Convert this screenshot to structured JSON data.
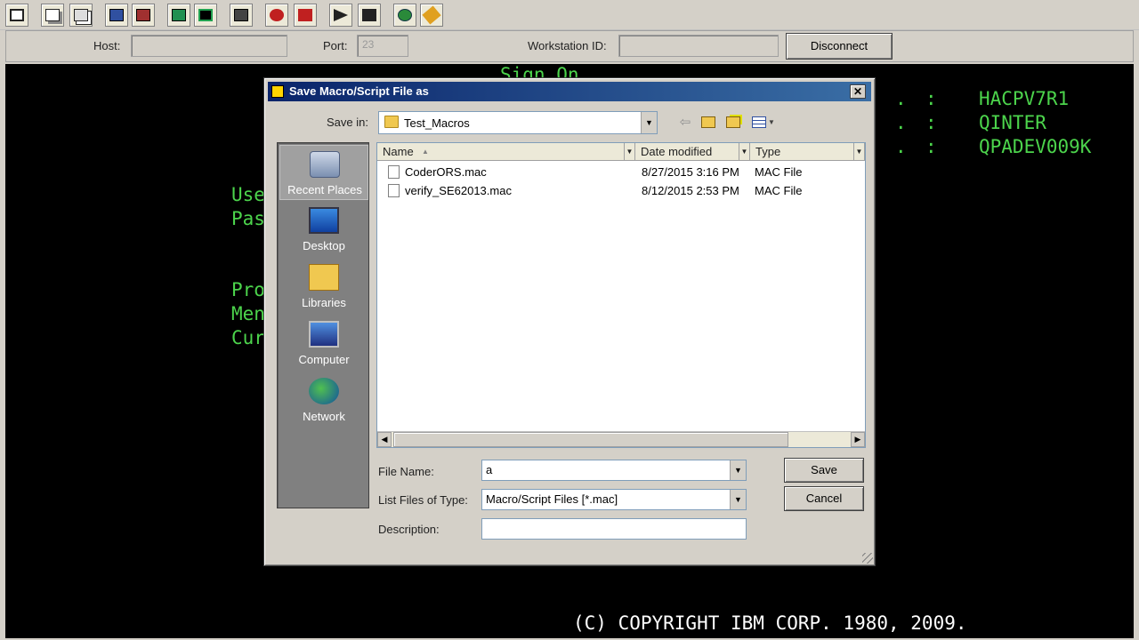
{
  "toolbar": {
    "icons": [
      "display-icon",
      "copy-icon",
      "paste-icon",
      "send-icon",
      "receive-icon",
      "keypad-icon",
      "display-settings-icon",
      "print-icon",
      "record-macro-icon",
      "stop-macro-icon",
      "play-macro-icon",
      "macro-step-icon",
      "globe-icon",
      "edit-macro-icon"
    ]
  },
  "hostbar": {
    "host_label": "Host:",
    "host_value": "",
    "port_label": "Port:",
    "port_value": "23",
    "workstation_label": "Workstation ID:",
    "workstation_value": "",
    "disconnect_label": "Disconnect"
  },
  "terminal": {
    "header_partial": "Sign On",
    "system_value": "HACPV7R1",
    "subsystem_value": "QINTER",
    "display_value": "QPADEV009K",
    "colon": ":",
    "dot": ".",
    "user_partial": "Use",
    "password_partial": "Pas",
    "program_partial": "Pro",
    "menu_partial": "Men",
    "current_partial": "Cur",
    "copyright": "(C) COPYRIGHT IBM CORP. 1980, 2009."
  },
  "dialog": {
    "title": "Save Macro/Script File as",
    "save_in_label": "Save in:",
    "save_in_value": "Test_Macros",
    "places": [
      {
        "label": "Recent Places",
        "icon": "recent-places-icon"
      },
      {
        "label": "Desktop",
        "icon": "desktop-icon"
      },
      {
        "label": "Libraries",
        "icon": "libraries-icon"
      },
      {
        "label": "Computer",
        "icon": "computer-icon"
      },
      {
        "label": "Network",
        "icon": "network-icon"
      }
    ],
    "columns": {
      "name": "Name",
      "date": "Date modified",
      "type": "Type"
    },
    "files": [
      {
        "name": "CoderORS.mac",
        "date": "8/27/2015 3:16 PM",
        "type": "MAC File"
      },
      {
        "name": "verify_SE62013.mac",
        "date": "8/12/2015 2:53 PM",
        "type": "MAC File"
      }
    ],
    "file_name_label": "File Name:",
    "file_name_value": "a",
    "file_type_label": "List Files of Type:",
    "file_type_value": "Macro/Script Files [*.mac]",
    "description_label": "Description:",
    "description_value": "",
    "save_label": "Save",
    "cancel_label": "Cancel",
    "close_glyph": "✕"
  }
}
